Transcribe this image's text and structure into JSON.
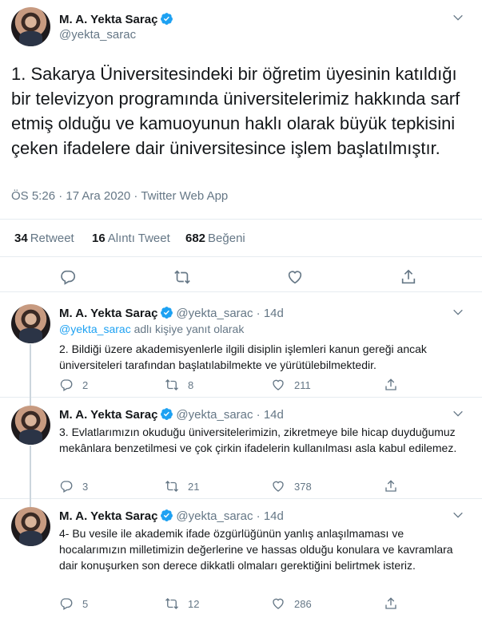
{
  "main_tweet": {
    "author_name": "M. A. Yekta Saraç",
    "handle": "@yekta_sarac",
    "text": "1. Sakarya Üniversitesindeki bir öğretim üyesinin katıldığı bir televizyon programında üniversitelerimiz hakkında sarf etmiş olduğu ve kamuoyunun haklı olarak büyük tepkisini çeken ifadelere dair üniversitesince işlem başlatılmıştır.",
    "meta": "ÖS 5:26 · 17 Ara 2020 · Twitter Web App",
    "stats": {
      "retweets_count": "34",
      "retweets_label": "Retweet",
      "quotes_count": "16",
      "quotes_label": "Alıntı Tweet",
      "likes_count": "682",
      "likes_label": "Beğeni"
    }
  },
  "replies": [
    {
      "author_name": "M. A. Yekta Saraç",
      "handle_time": "@yekta_sarac · 14d",
      "reply_to_link": "@yekta_sarac",
      "reply_to_suffix": " adlı kişiye yanıt olarak",
      "text": "2. Bildiği üzere akademisyenlerle ilgili disiplin işlemleri kanun gereği ancak üniversiteleri tarafından başlatılabilmekte ve yürütülebilmektedir.",
      "replies": "2",
      "retweets": "8",
      "likes": "211"
    },
    {
      "author_name": "M. A. Yekta Saraç",
      "handle_time": "@yekta_sarac · 14d",
      "text": "3. Evlatlarımızın okuduğu üniversitelerimizin, zikretmeye bile hicap duyduğumuz mekânlara benzetilmesi ve çok çirkin ifadelerin kullanılması asla kabul edilemez.",
      "replies": "3",
      "retweets": "21",
      "likes": "378"
    },
    {
      "author_name": "M. A. Yekta Saraç",
      "handle_time": "@yekta_sarac · 14d",
      "text": "4- Bu vesile ile akademik ifade özgürlüğünün yanlış anlaşılmaması ve hocalarımızın milletimizin değerlerine ve hassas olduğu konulara ve kavramlara dair konuşurken son derece dikkatli olmaları gerektiğini belirtmek isteriz.",
      "replies": "5",
      "retweets": "12",
      "likes": "286"
    }
  ],
  "colors": {
    "accent": "#1da1f2",
    "text": "#14171a",
    "secondary": "#657786",
    "border": "#e6ecf0"
  },
  "icons": [
    "verified-icon",
    "chevron-down-icon",
    "reply-icon",
    "retweet-icon",
    "like-icon",
    "share-icon"
  ]
}
